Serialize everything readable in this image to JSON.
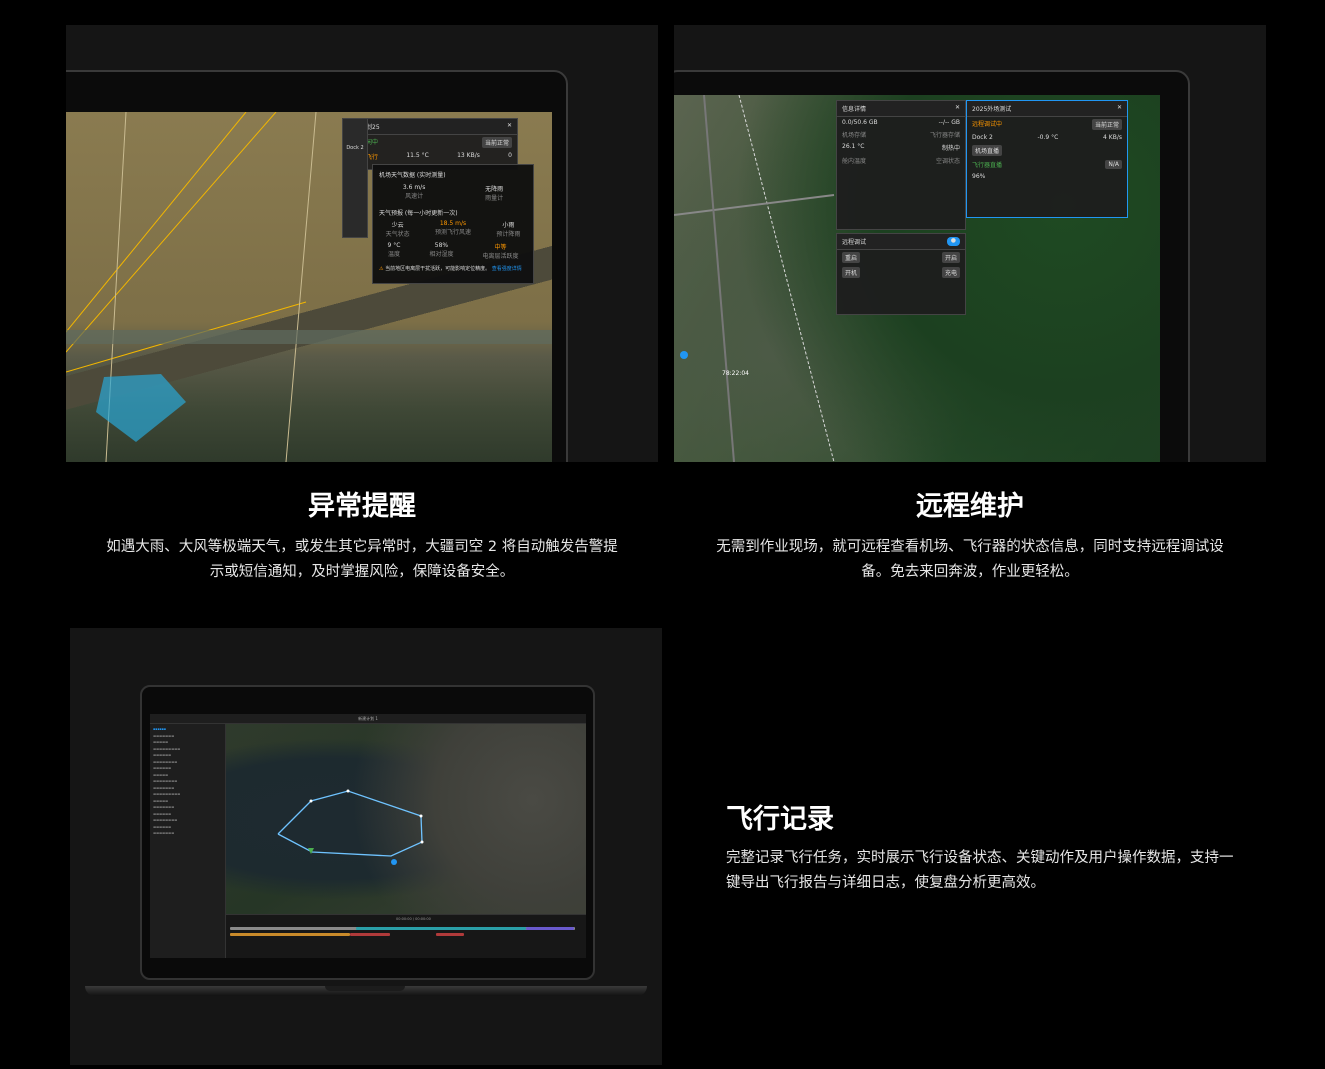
{
  "sections": [
    {
      "title": "异常提醒",
      "description": "如遇大雨、大风等极端天气，或发生其它异常时，大疆司空 2 将自动触发告警提示或短信通知，及时掌握风险，保障设备安全。"
    },
    {
      "title": "远程维护",
      "description": "无需到作业现场，就可远程查看机场、飞行器的状态信息，同时支持远程调试设备。免去来回奔波，作业更轻松。"
    },
    {
      "title": "飞行记录",
      "description": "完整记录飞行任务，实时展示飞行设备状态、关键动作及用户操作数据，支持一键导出飞行报告与详细日志，使复盘分析更高效。"
    }
  ],
  "screen1": {
    "dock_label": "Dock 2",
    "plan_name": "新建计划25",
    "status_online": "设备空闲中",
    "status_ok": "当前正常",
    "no_flight": "不建议飞行",
    "temp": "11.5 °C",
    "speed": "13 KB/s",
    "count": "0",
    "weather_title": "机场天气数据 (实时测量)",
    "wind_value": "3.6 m/s",
    "wind_label": "风速计",
    "rain_value": "无降雨",
    "rain_label": "雨量计",
    "forecast_title": "天气预报 (每一小时更新一次)",
    "f1_value": "少云",
    "f1_label": "天气状态",
    "f2_value": "18.5 m/s",
    "f2_label": "预测飞行风速",
    "f3_value": "小雨",
    "f3_label": "预计降雨",
    "f4_value": "9 °C",
    "f4_label": "温度",
    "f5_value": "58%",
    "f5_label": "相对湿度",
    "f6_value": "中等",
    "f6_label": "电离层活跃度",
    "warning": "当前地区电离层干扰活跃，可能影响定位精度。",
    "warning_link": "查看强度详情"
  },
  "screen2": {
    "info_title": "信息详情",
    "v1": "0.0/50.6 GB",
    "v1_label": "机场存储",
    "v2": "--/-- GB",
    "v2_label": "飞行器存储",
    "v3": "26.1 °C",
    "v3_label": "舱内温度",
    "v4": "制热中",
    "v4_label": "空调状态",
    "remote_title": "远程调试",
    "btn_reboot": "重启",
    "btn_on": "开启",
    "btn_power": "开机",
    "btn_charge": "充电",
    "dock_name": "2025外场测试",
    "dock_label": "Dock 2",
    "dock_status": "远程调试中",
    "dock_ok": "当前正常",
    "dock_live": "机场直播",
    "aircraft": "飞行器直播",
    "na": "N/A",
    "temp": "-0.9 °C",
    "speed": "4 KB/s",
    "battery": "96%",
    "map_label": "78:22:04"
  },
  "screen3": {
    "plan_name": "新建计划 1",
    "timeline_time": "00:00:00 / 00:00:00"
  }
}
